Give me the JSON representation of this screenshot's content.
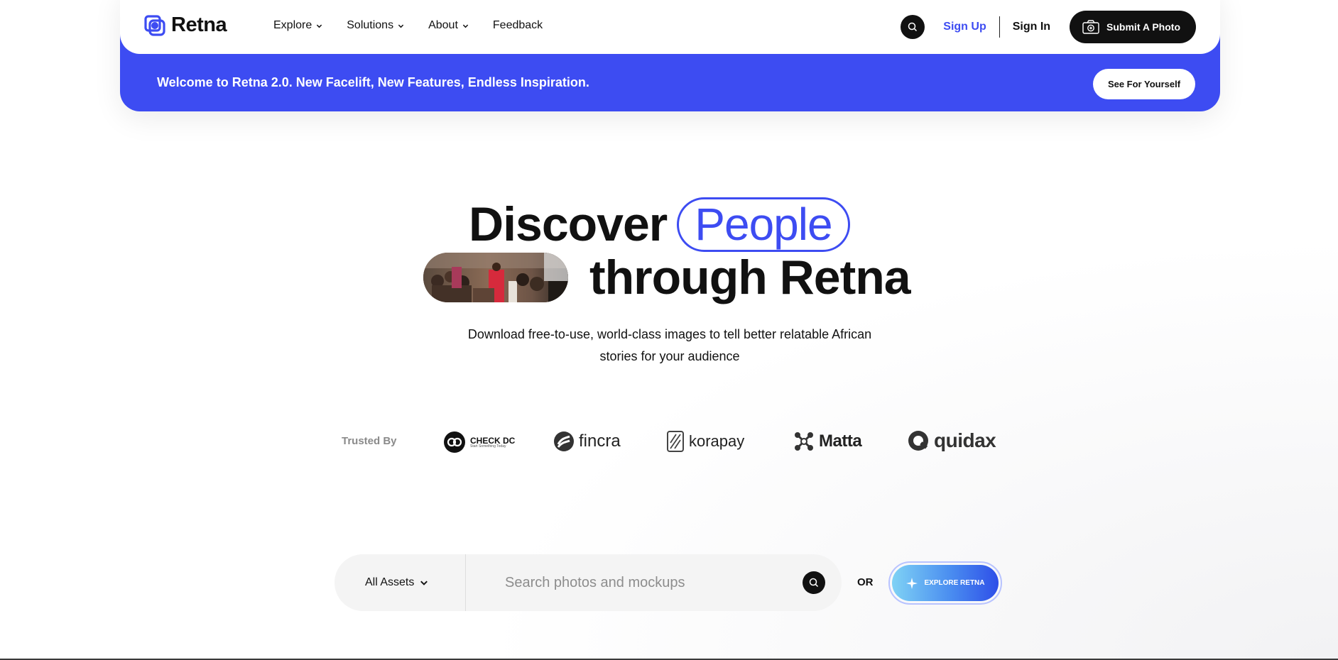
{
  "brand": {
    "name": "Retna",
    "accent": "#3d4cf2"
  },
  "nav": {
    "items": [
      {
        "label": "Explore",
        "has_menu": true
      },
      {
        "label": "Solutions",
        "has_menu": true
      },
      {
        "label": "About",
        "has_menu": true
      },
      {
        "label": "Feedback",
        "has_menu": false
      }
    ],
    "sign_up": "Sign Up",
    "sign_in": "Sign In",
    "submit": "Submit A Photo"
  },
  "banner": {
    "text": "Welcome to Retna 2.0. New Facelift, New Features, Endless Inspiration.",
    "button": "See For Yourself"
  },
  "hero": {
    "word1": "Discover",
    "highlight": "People",
    "word2": "through Retna",
    "subtitle": "Download free-to-use, world-class images to tell better relatable African stories for your audience"
  },
  "trusted": {
    "label": "Trusted By",
    "logos": [
      "CHECK DC",
      "fincra",
      "korapay",
      "Matta",
      "quidax"
    ],
    "checkdc_tagline": "Start Something Today"
  },
  "search": {
    "category": "All Assets",
    "placeholder": "Search photos and mockups",
    "or": "OR",
    "explore": "EXPLORE RETNA"
  }
}
